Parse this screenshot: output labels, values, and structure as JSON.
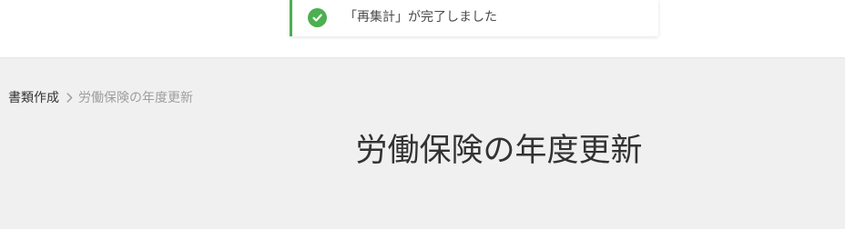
{
  "toast": {
    "message": "「再集計」が完了しました",
    "accent_color": "#4caf50",
    "icon": "check-circle-icon"
  },
  "breadcrumb": {
    "parent": "書類作成",
    "separator_icon": "chevron-right-icon",
    "current": "労働保険の年度更新"
  },
  "page": {
    "title": "労働保険の年度更新"
  }
}
